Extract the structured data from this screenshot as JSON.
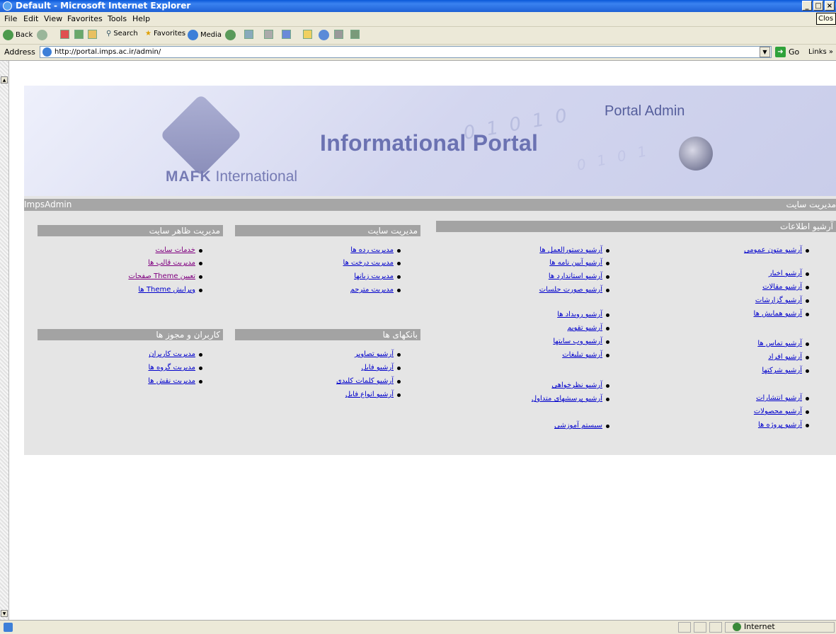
{
  "window": {
    "title": "Default - Microsoft Internet Explorer",
    "min_label": "_",
    "max_label": "□",
    "close_label": "×",
    "close_tooltip": "Clos"
  },
  "menu": [
    "File",
    "Edit",
    "View",
    "Favorites",
    "Tools",
    "Help"
  ],
  "toolbar": {
    "back": "Back",
    "search": "Search",
    "favorites": "Favorites",
    "media": "Media"
  },
  "address": {
    "label": "Address",
    "url": "http://portal.imps.ac.ir/admin/",
    "go": "Go",
    "links": "Links »"
  },
  "banner": {
    "brand": "MAFK",
    "brand_sub": "International",
    "title": "Informational Portal",
    "admin": "Portal Admin",
    "bits1": "0 1 0 1 0",
    "bits2": "0 1 0 1"
  },
  "adminbar": {
    "left": "ImpsAdmin",
    "right": "مدیریت سایت"
  },
  "sections": {
    "archive": {
      "title": "آرشیو اطلاعات",
      "right_links": [
        "آرشیو متون عمومی",
        "آرشیو اخبار",
        "آرشیو مقالات",
        "آرشیو گزارشات",
        "آرشیو همایش ها",
        "آرشیو تماس ها",
        "آرشیو افراد",
        "آرشیو شرکتها",
        "آرشیو انتشارات",
        "آرشیو محصولات",
        "آرشیو پروژه ها"
      ],
      "mid_links": [
        "آرشیو دستورالعمل ها",
        "آرشیو آیین نامه ها",
        "آرشیو استاندارد ها",
        "آرشیو صورت جلسات",
        "آرشیو رویداد ها",
        "آرشیو تقویم",
        "آرشیو وب سایتها",
        "آرشیو تبلیغات",
        "آرشیو نظرخواهی",
        "آرشیو پرسشهای متداول",
        "سیستم آموزشی"
      ]
    },
    "site": {
      "title": "مدیریت سایت",
      "links": [
        "مدیریت رده ها",
        "مدیریت درخت ها",
        "مدیریت زبانها",
        "مدیریت مترجم"
      ]
    },
    "appearance": {
      "title": "مدیریت ظاهر سایت",
      "links": [
        "خدمات سایت",
        "مدیریت قالب ها",
        "تعیین Theme صفحات",
        "ویرایش Theme ها"
      ]
    },
    "banks": {
      "title": "بانکهای ها",
      "links": [
        "آرشیو تصاویر",
        "آرشیو فایل",
        "آرشیو کلمات کلیدی",
        "آرشیو انواع فایل"
      ]
    },
    "users": {
      "title": "کاربران و مجوز ها",
      "links": [
        "مدیریت کاربران",
        "مدیریت گروه ها",
        "مدیریت نقش ها"
      ]
    }
  },
  "status": {
    "zone": "Internet"
  },
  "colors": {
    "link": "#0000cc",
    "visited": "#800080",
    "header_gray": "#a3a3a3",
    "titlebar": "#0a58d8"
  }
}
